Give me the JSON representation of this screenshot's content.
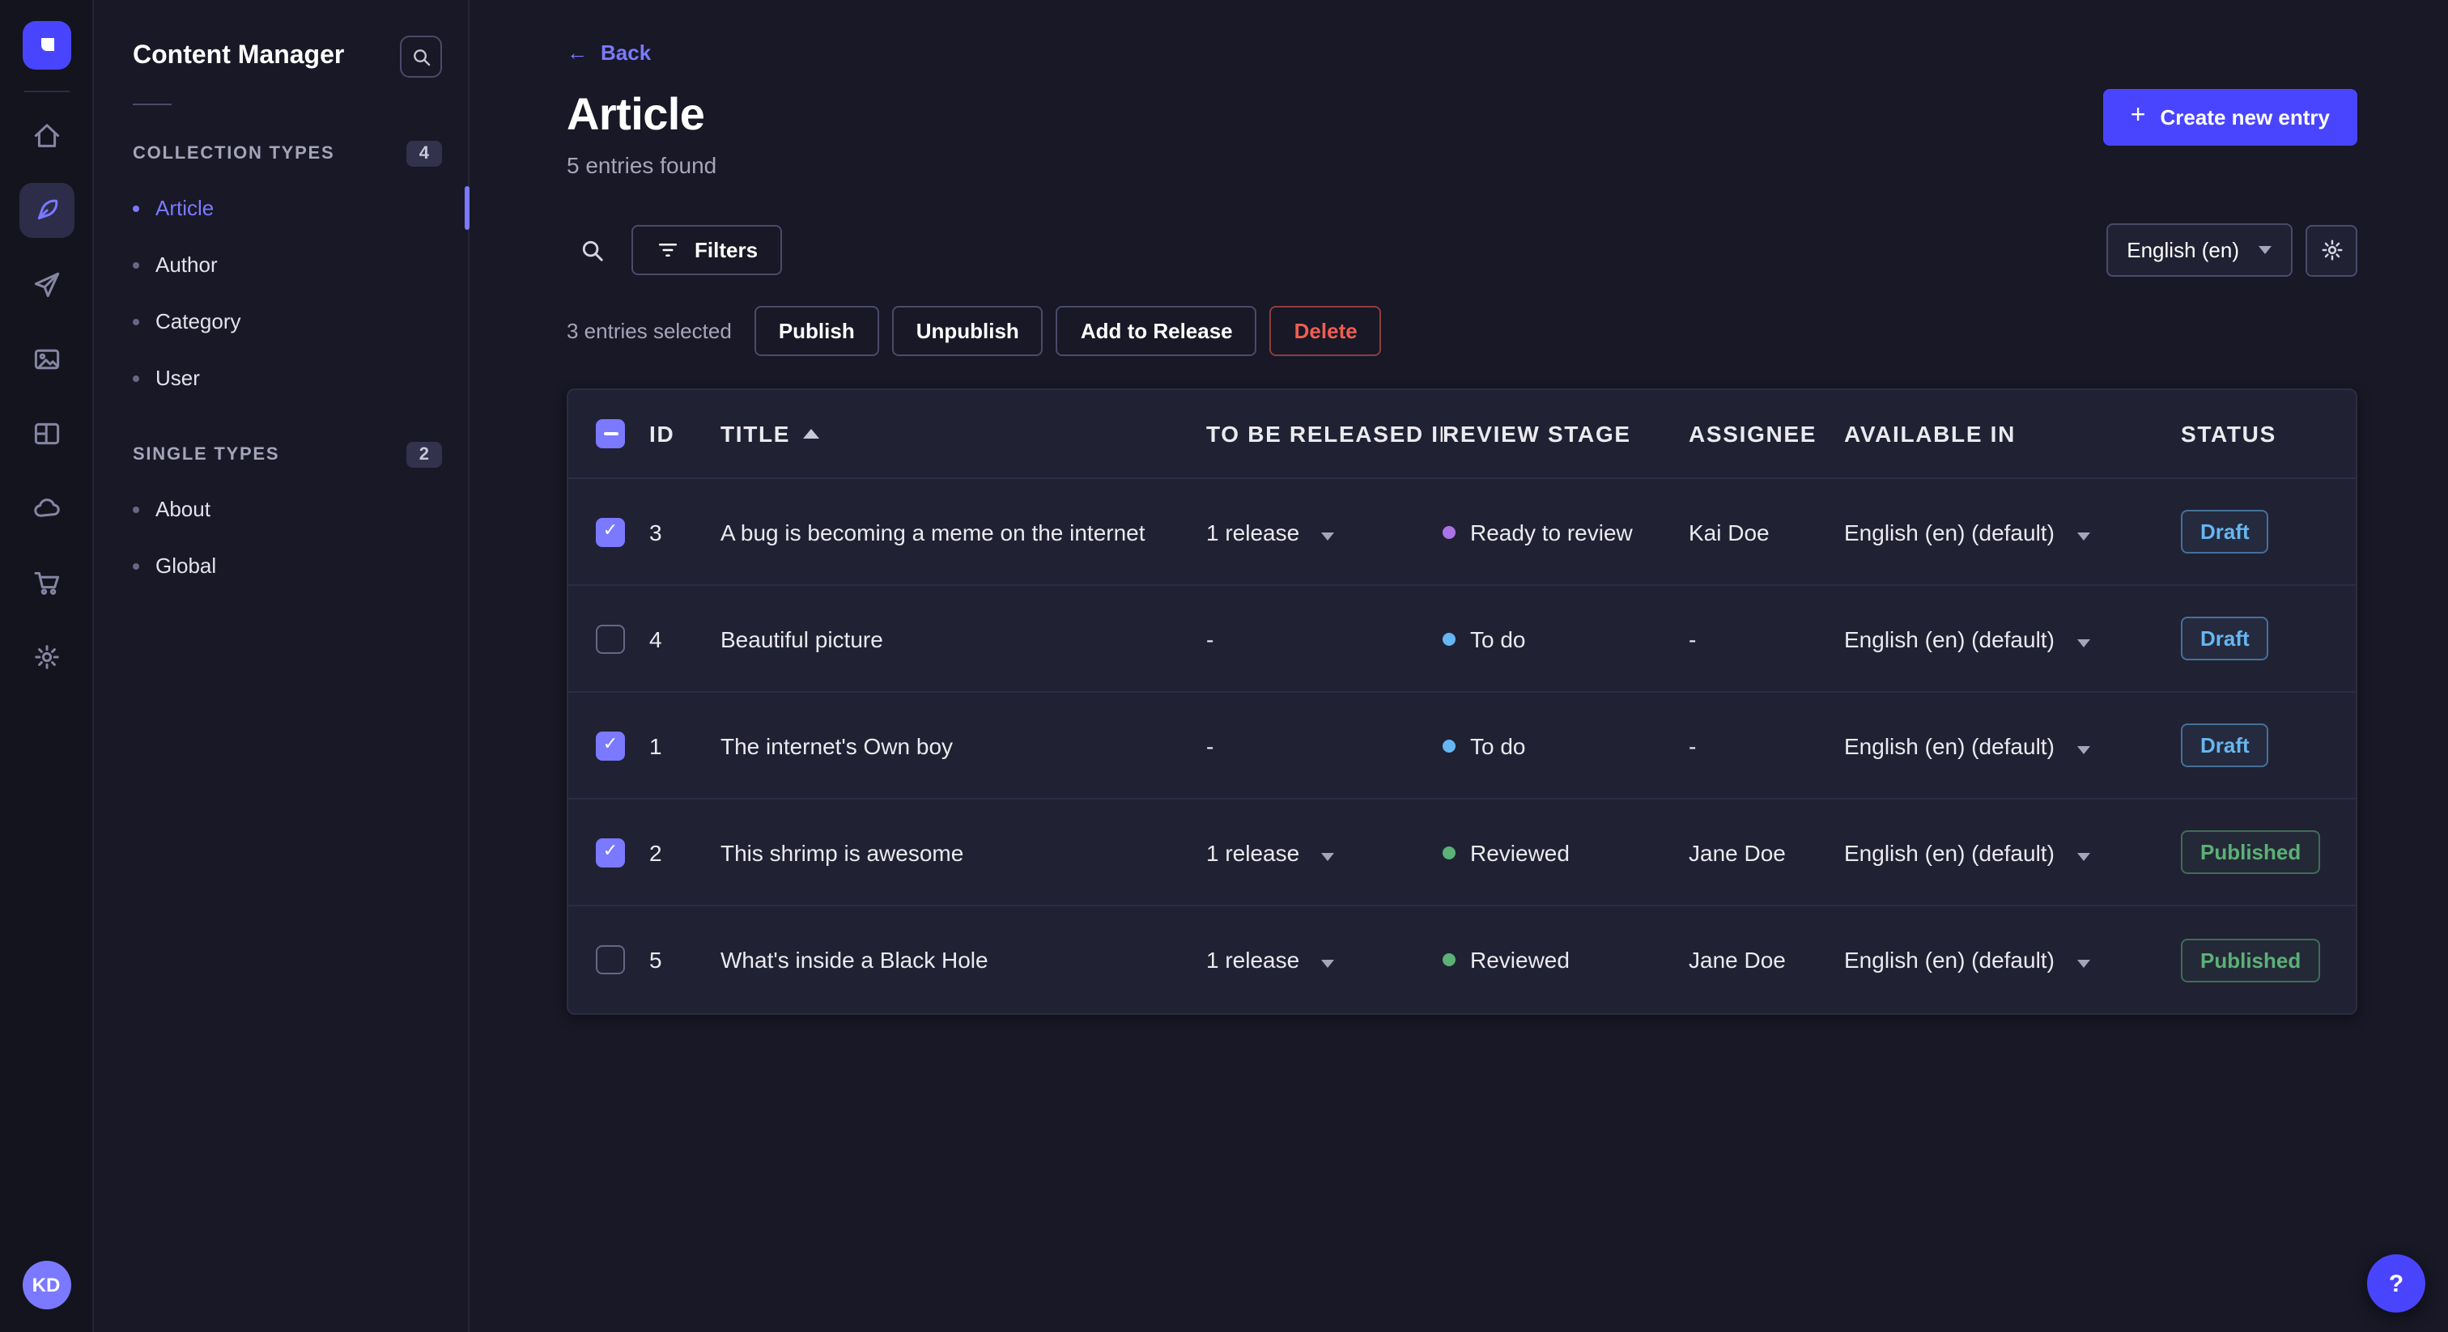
{
  "icons": {
    "back_arrow": "←",
    "plus": "+",
    "check": "✓"
  },
  "nav": {
    "avatar_initials": "KD",
    "items": [
      {
        "icon": "home-icon",
        "active": false
      },
      {
        "icon": "content-manager-icon",
        "active": true
      },
      {
        "icon": "transfer-icon",
        "active": false
      },
      {
        "icon": "media-library-icon",
        "active": false
      },
      {
        "icon": "content-type-builder-icon",
        "active": false
      },
      {
        "icon": "cloud-icon",
        "active": false
      },
      {
        "icon": "marketplace-icon",
        "active": false
      },
      {
        "icon": "settings-icon",
        "active": false
      }
    ]
  },
  "sidebar": {
    "title": "Content Manager",
    "sections": [
      {
        "label": "Collection Types",
        "badge": "4",
        "items": [
          {
            "label": "Article",
            "active": true
          },
          {
            "label": "Author",
            "active": false
          },
          {
            "label": "Category",
            "active": false
          },
          {
            "label": "User",
            "active": false
          }
        ]
      },
      {
        "label": "Single Types",
        "badge": "2",
        "items": [
          {
            "label": "About",
            "active": false
          },
          {
            "label": "Global",
            "active": false
          }
        ]
      }
    ]
  },
  "header": {
    "back_label": "Back",
    "title": "Article",
    "subtitle": "5 entries found",
    "create_button_label": "Create new entry"
  },
  "toolbar": {
    "filters_label": "Filters",
    "locale_selected": "English (en)"
  },
  "selection": {
    "summary": "3 entries selected",
    "publish_label": "Publish",
    "unpublish_label": "Unpublish",
    "add_to_release_label": "Add to Release",
    "delete_label": "Delete"
  },
  "table": {
    "columns": [
      "ID",
      "TITLE",
      "TO BE RELEASED IN",
      "REVIEW STAGE",
      "ASSIGNEE",
      "AVAILABLE IN",
      "STATUS"
    ],
    "rows": [
      {
        "checked": true,
        "id": "3",
        "title": "A bug is becoming a meme on the internet",
        "release": "1 release",
        "stage": "Ready to review",
        "stage_color": "#ac73e6",
        "assignee": "Kai Doe",
        "locale": "English (en) (default)",
        "status": "Draft"
      },
      {
        "checked": false,
        "id": "4",
        "title": "Beautiful picture",
        "release": "-",
        "stage": "To do",
        "stage_color": "#66b7f1",
        "assignee": "-",
        "locale": "English (en) (default)",
        "status": "Draft"
      },
      {
        "checked": true,
        "id": "1",
        "title": "The internet's Own boy",
        "release": "-",
        "stage": "To do",
        "stage_color": "#66b7f1",
        "assignee": "-",
        "locale": "English (en) (default)",
        "status": "Draft"
      },
      {
        "checked": true,
        "id": "2",
        "title": "This shrimp is awesome",
        "release": "1 release",
        "stage": "Reviewed",
        "stage_color": "#5cb176",
        "assignee": "Jane Doe",
        "locale": "English (en) (default)",
        "status": "Published"
      },
      {
        "checked": false,
        "id": "5",
        "title": "What's inside a Black Hole",
        "release": "1 release",
        "stage": "Reviewed",
        "stage_color": "#5cb176",
        "assignee": "Jane Doe",
        "locale": "English (en) (default)",
        "status": "Published"
      }
    ]
  },
  "help": {
    "label": "?"
  },
  "colors": {
    "accent": "#4945ff",
    "accent_light": "#7b79ff",
    "background": "#181826",
    "surface": "#212134",
    "danger": "#ee5e52",
    "draft_text": "#66b7f1",
    "published_text": "#5cb176",
    "stage_purple": "#ac73e6",
    "stage_blue": "#66b7f1",
    "stage_green": "#5cb176"
  }
}
